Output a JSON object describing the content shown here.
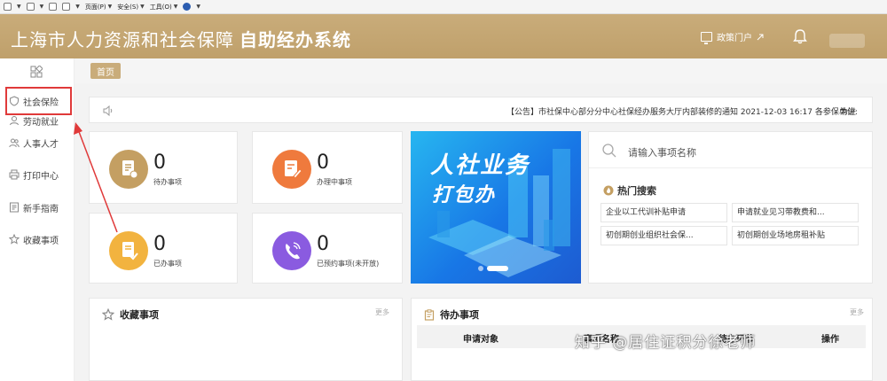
{
  "ie_toolbar": {
    "page_menu": "页面(P)",
    "safety_menu": "安全(S)",
    "tools_menu": "工具(O)"
  },
  "header": {
    "title_light": "上海市人力资源和社会保障",
    "title_bold": "自助经办系统",
    "portal_link": "政策门户"
  },
  "sidebar": {
    "items": [
      {
        "label": "社会保险",
        "icon": "shield-icon"
      },
      {
        "label": "劳动就业",
        "icon": "worker-icon"
      },
      {
        "label": "人事人才",
        "icon": "people-icon"
      },
      {
        "label": "打印中心",
        "icon": "printer-icon"
      },
      {
        "label": "新手指南",
        "icon": "guide-icon"
      },
      {
        "label": "收藏事项",
        "icon": "star-icon"
      }
    ]
  },
  "tabs": {
    "home": "首页"
  },
  "notice": {
    "text": "【公告】市社保中心部分分中心社保经办服务大厅内部装修的通知 2021-12-03 16:17 各参保单位:",
    "tail": "为进"
  },
  "stats": [
    {
      "value": "0",
      "label": "待办事项",
      "color": "#c49f62"
    },
    {
      "value": "0",
      "label": "办理中事项",
      "color": "#ef7a3d"
    },
    {
      "value": "0",
      "label": "已办事项",
      "color": "#f2b33f"
    },
    {
      "value": "0",
      "label": "已预约事项(未开放)",
      "color": "#8a5be0"
    }
  ],
  "banner": {
    "line1": "人社业务",
    "line2": "打包办"
  },
  "search": {
    "placeholder": "请输入事项名称",
    "hot_title": "热门搜索",
    "hot_items": [
      "企业以工代训补贴申请",
      "申请就业见习带教费和...",
      "初创期创业组织社会保...",
      "初创期创业场地房租补贴"
    ]
  },
  "favorites": {
    "title": "收藏事项",
    "more": "更多"
  },
  "todo": {
    "title": "待办事项",
    "more": "更多",
    "columns": [
      "申请对象",
      "事项名称",
      "待办环节",
      "操作"
    ]
  },
  "watermark": "知乎 @居住证积分徐老师"
}
